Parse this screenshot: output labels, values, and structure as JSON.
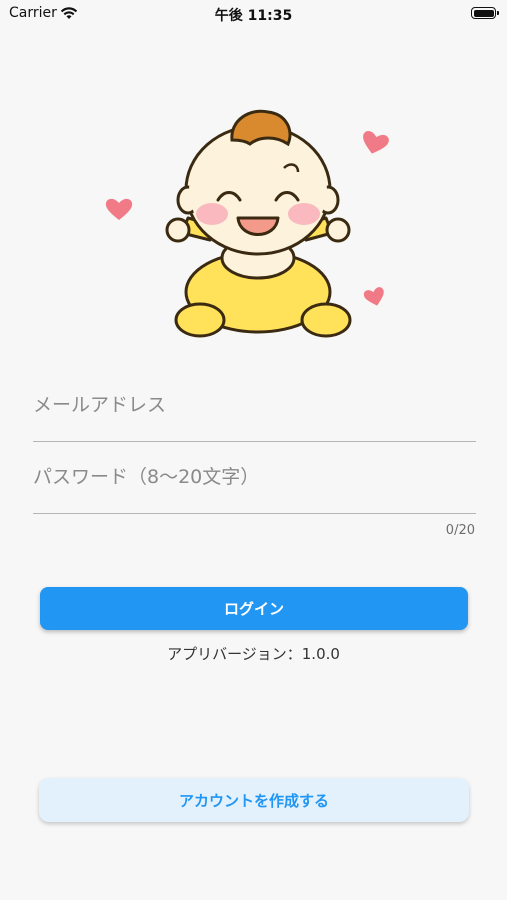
{
  "status_bar": {
    "carrier": "Carrier",
    "time": "午後 11:35"
  },
  "mascot": {
    "icon": "baby-illustration-icon",
    "colors": {
      "suit": "#ffe15a",
      "hair": "#d98a2e",
      "heart": "#f07b86"
    }
  },
  "form": {
    "email_placeholder": "メールアドレス",
    "email_value": "",
    "password_placeholder": "パスワード（8〜20文字）",
    "password_value": "",
    "password_counter": "0/20"
  },
  "login_label": "ログイン",
  "app_version": "アプリバージョン：1.0.0",
  "create_account_label": "アカウントを作成する",
  "colors": {
    "primary": "#2196f3",
    "secondary_bg": "#e3f1fd"
  }
}
